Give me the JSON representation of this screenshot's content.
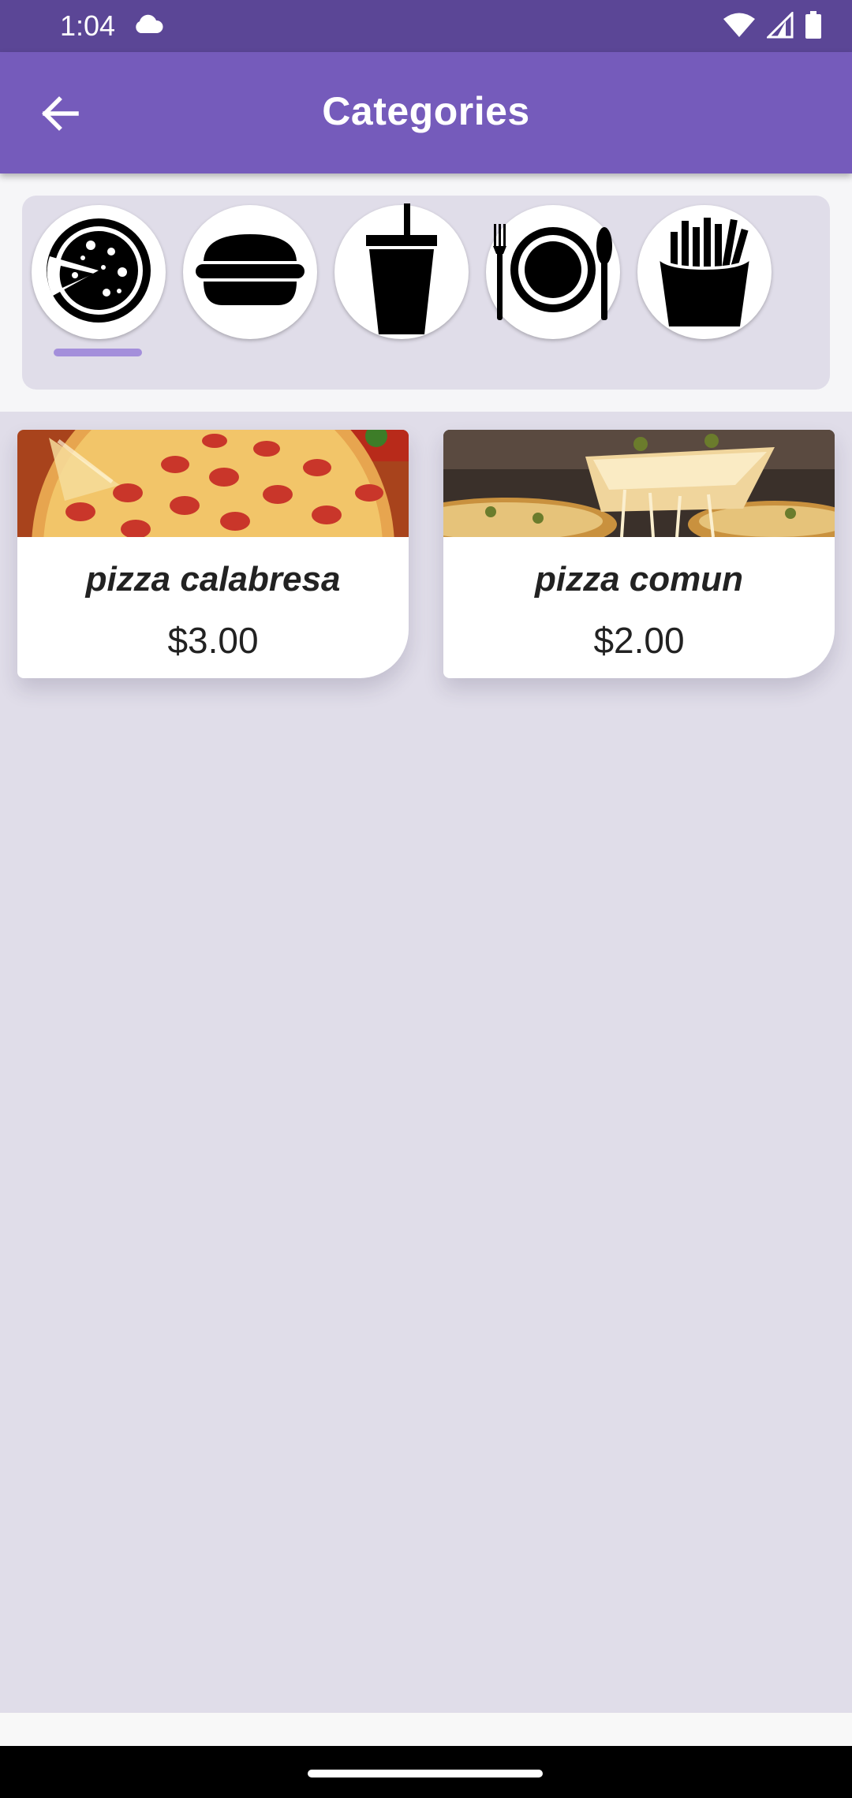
{
  "status_bar": {
    "time": "1:04",
    "icons": [
      "cloud-icon",
      "wifi-icon",
      "signal-icon",
      "battery-icon"
    ]
  },
  "app_bar": {
    "title": "Categories",
    "back_icon": "arrow-left-icon"
  },
  "categories": {
    "items": [
      {
        "icon": "pizza-icon",
        "selected": true
      },
      {
        "icon": "burger-icon",
        "selected": false
      },
      {
        "icon": "drink-icon",
        "selected": false
      },
      {
        "icon": "plate-icon",
        "selected": false
      },
      {
        "icon": "fries-icon",
        "selected": false
      }
    ]
  },
  "products": [
    {
      "name": "pizza calabresa",
      "price": "$3.00",
      "image": "pepperoni-pizza-photo"
    },
    {
      "name": "pizza comun",
      "price": "$2.00",
      "image": "cheese-pizza-photo"
    }
  ],
  "colors": {
    "status_bar": "#5b4696",
    "app_bar": "#755bbb",
    "background": "#e0dde9",
    "indicator": "#a48fdb"
  }
}
